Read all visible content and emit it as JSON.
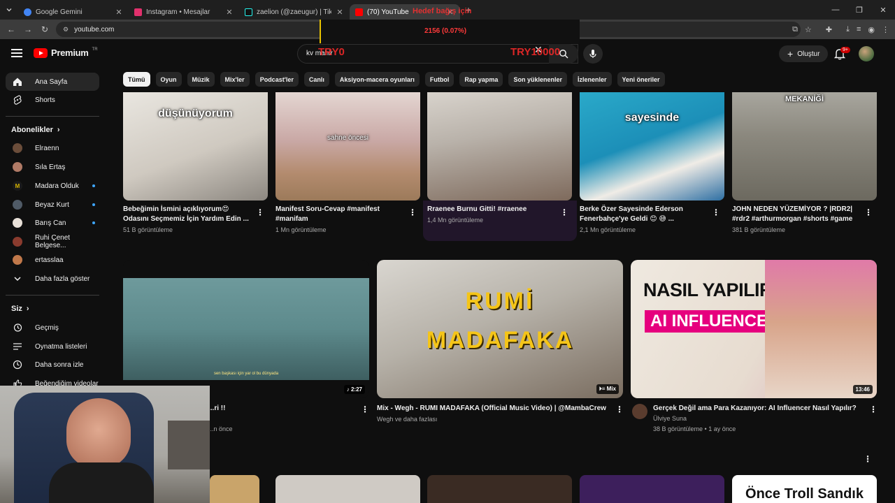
{
  "browser": {
    "tabs": [
      {
        "label": "Google Gemini",
        "color": "#4285f4"
      },
      {
        "label": "Instagram • Mesajlar",
        "color": "#e1306c"
      },
      {
        "label": "zaelion (@zaeugur) | TikTok",
        "color": "#25f4ee"
      },
      {
        "label": "(70) YouTube",
        "color": "#ff0000"
      }
    ],
    "url": "youtube.com"
  },
  "overlay": {
    "goal_text": "Hedef bağış için",
    "percent": "2156 (0.07%)",
    "currency_left": "TRY0",
    "currency_right": "TRY10000"
  },
  "header": {
    "brand": "Premium",
    "region": "TR",
    "search_value": "kv mahir",
    "create_label": "Oluştur",
    "notif_count": "9+"
  },
  "sidebar": {
    "main": [
      {
        "label": "Ana Sayfa",
        "icon": "home-icon"
      },
      {
        "label": "Shorts",
        "icon": "shorts-icon"
      }
    ],
    "subs_heading": "Abonelikler",
    "subs": [
      {
        "label": "Elraenn",
        "color": "#6b4d3a",
        "live": false
      },
      {
        "label": "Sıla Ertaş",
        "color": "#b07a66",
        "live": false
      },
      {
        "label": "Madara Olduk",
        "color": "#d4b200",
        "live": true
      },
      {
        "label": "Beyaz Kurt",
        "color": "#4f5a66",
        "live": true
      },
      {
        "label": "Barış Can",
        "color": "#e8e0d8",
        "live": true
      },
      {
        "label": "Ruhi Çenet Belgese...",
        "color": "#8a3b2e",
        "live": false
      },
      {
        "label": "ertasslaa",
        "color": "#c0784a",
        "live": false
      }
    ],
    "show_more": "Daha fazla göster",
    "you_heading": "Siz",
    "you": [
      {
        "label": "Geçmiş",
        "icon": "history-icon"
      },
      {
        "label": "Oynatma listeleri",
        "icon": "playlist-icon"
      },
      {
        "label": "Daha sonra izle",
        "icon": "clock-icon"
      },
      {
        "label": "Beğendiğim videolar",
        "icon": "like-icon"
      }
    ]
  },
  "chips": [
    "Tümü",
    "Oyun",
    "Müzik",
    "Mix'ler",
    "Podcast'ler",
    "Canlı",
    "Aksiyon-macera oyunları",
    "Futbol",
    "Rap yapma",
    "Son yüklenenler",
    "İzlenenler",
    "Yeni öneriler"
  ],
  "shorts": [
    {
      "caption": "düşünüyorum",
      "title": "Bebeğimin İsmini açıklıyorum😍 Odasını Seçmemiz İçin Yardım Edin ...",
      "views": "51 B görüntüleme",
      "bg": "linear-gradient(160deg,#e9e6e0 0%,#cfc9c0 55%,#8c8780 100%)"
    },
    {
      "caption": "sahne öncesi",
      "title": "Manifest Soru-Cevap #manifest #manifam",
      "views": "1 Mn görüntüleme",
      "bg": "linear-gradient(180deg,#e4d6d2 0%,#c9a8a5 45%,#b38b6e 75%,#9c7a5a 100%)"
    },
    {
      "caption": "",
      "title": "Rraenee Burnu Gitti!  #rraenee",
      "views": "1,4 Mn görüntüleme",
      "bg": "linear-gradient(170deg,#d8d3cc 0%,#b9b2aa 40%,#7e6a5c 100%)"
    },
    {
      "caption": "sayesinde",
      "title": "Berke Özer Sayesinde Ederson Fenerbahçe'ye Geldi 😊 😅 ...",
      "views": "2,1 Mn görüntüleme",
      "bg": "linear-gradient(160deg,#2aa9c9 0%,#1c8fb8 45%,#f0ece6 70%,#2e6fa3 100%)"
    },
    {
      "caption": "MEKANİĞİ",
      "title": "JOHN NEDEN YÜZEMİYOR ? |RDR2| #rdr2 #arthurmorgan #shorts #game",
      "views": "381 B görüntüleme",
      "bg": "linear-gradient(180deg,#a8a69e 0%,#8b887e 40%,#6c695f 100%)"
    }
  ],
  "videos": [
    {
      "title": "...ri !!",
      "channel": "",
      "meta": "...n önce",
      "duration": "2:27",
      "subtitle": "sen başkası için yar ol bu dünyada",
      "bg": "linear-gradient(180deg,#6e9a9c 0%,#5d8a8c 50%,#3e5f61 100%)"
    },
    {
      "title": "Mix - Wegh - RUMI MADAFAKA (Official Music Video) | @MambaCrew",
      "channel": "Wegh ve daha fazlası",
      "meta": "",
      "duration": "Mix",
      "overlay_l1": "RUMİ",
      "overlay_l2": "MADAFAKA",
      "bg": "linear-gradient(160deg,#d9d6d0 0%,#b6b1a8 45%,#7a6d60 100%)"
    },
    {
      "title": "Gerçek Değil ama Para Kazanıyor: AI Influencer Nasıl Yapılır?",
      "channel": "Ülviye Suna",
      "meta": "38 B görüntüleme • 1 ay önce",
      "duration": "13:46",
      "overlay_l1": "NASIL YAPILIR",
      "overlay_l2": "AI INFLUENCER",
      "bg": "linear-gradient(120deg,#efe9e0 0%,#e7dcd0 55%,#d9a9b5 100%)"
    }
  ],
  "bottom_row": [
    {
      "bg": "#c9a46a",
      "caption": ""
    },
    {
      "bg": "#cfcac4",
      "caption": ""
    },
    {
      "bg": "#3a2b23",
      "caption": ""
    },
    {
      "bg": "#3d1f5c",
      "caption": ""
    },
    {
      "bg": "#ffffff",
      "caption": "Önce Troll Sandık"
    }
  ]
}
